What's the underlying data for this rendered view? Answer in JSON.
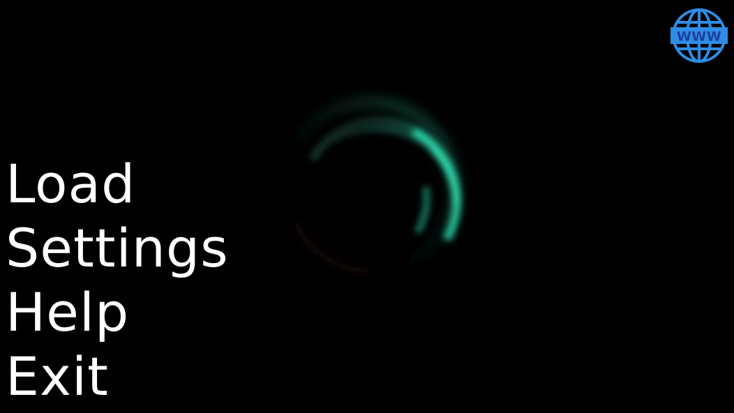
{
  "menu": {
    "items": [
      {
        "id": "load",
        "label": "Load"
      },
      {
        "id": "settings",
        "label": "Settings"
      },
      {
        "id": "help",
        "label": "Help"
      },
      {
        "id": "exit",
        "label": "Exit"
      }
    ]
  },
  "web_button": {
    "icon": "globe-www-icon",
    "label": "WWW",
    "color": "#2f8de4",
    "text_color": "#1f3f9f"
  },
  "loading_spinner": {
    "icon": "loading-ring-icon",
    "accent_color": "#2ee8b6",
    "trail_color": "#3a1010"
  },
  "colors": {
    "background": "#000000",
    "menu_text": "#ffffff"
  }
}
